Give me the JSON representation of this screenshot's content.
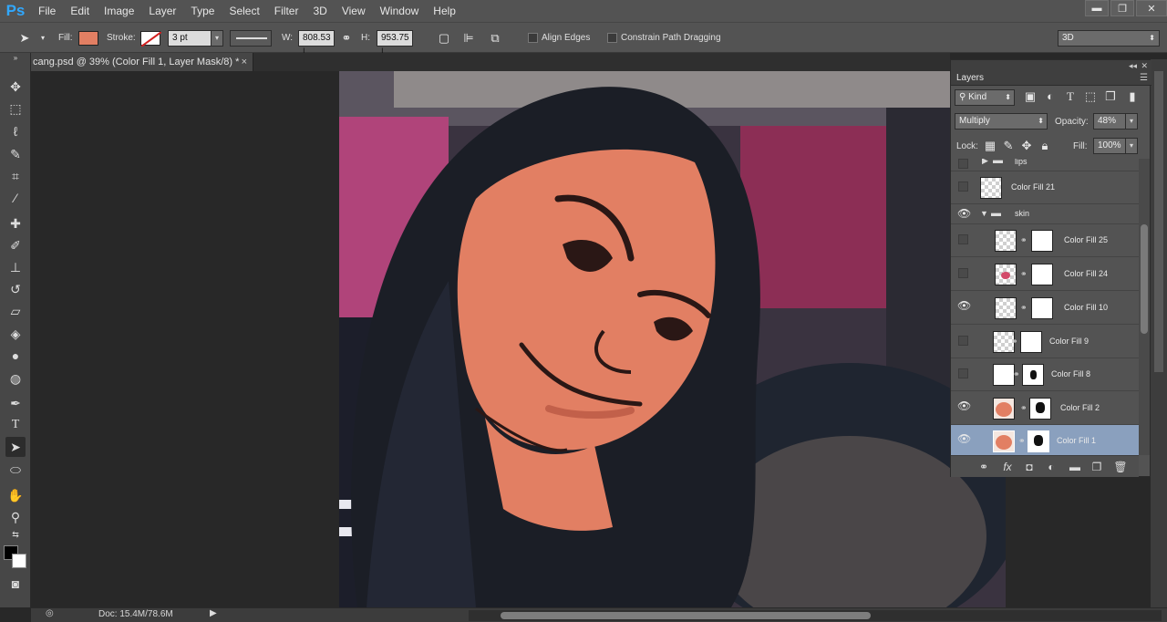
{
  "app": {
    "logo": "Ps"
  },
  "menu": [
    "File",
    "Edit",
    "Image",
    "Layer",
    "Type",
    "Select",
    "Filter",
    "3D",
    "View",
    "Window",
    "Help"
  ],
  "window_controls": {
    "minimize": "▬",
    "restore": "❐",
    "close": "✕"
  },
  "options": {
    "fill_label": "Fill:",
    "fill_color": "#e27f63",
    "stroke_label": "Stroke:",
    "stroke_width": "3 pt",
    "w_label": "W:",
    "w_value": "808.53 |",
    "h_label": "H:",
    "h_value": "953.75 |",
    "align_edges": "Align Edges",
    "constrain_path": "Constrain Path Dragging",
    "workspace": "3D"
  },
  "document": {
    "tab_title": "cang.psd @ 39% (Color Fill 1, Layer Mask/8) *",
    "close": "×"
  },
  "status": {
    "doc_size": "Doc: 15.4M/78.6M"
  },
  "layers_panel": {
    "title": "Layers",
    "filter_kind": "Kind",
    "blend_mode": "Multiply",
    "opacity_label": "Opacity:",
    "opacity_value": "48%",
    "lock_label": "Lock:",
    "fill_label": "Fill:",
    "fill_value": "100%",
    "layers": [
      {
        "name": "lips",
        "type": "group",
        "visible": false,
        "expanded": false
      },
      {
        "name": "Color Fill 21",
        "type": "fill",
        "visible": false
      },
      {
        "name": "skin",
        "type": "group",
        "visible": true,
        "expanded": true
      },
      {
        "name": "Color Fill 25",
        "type": "fill",
        "visible": false
      },
      {
        "name": "Color Fill 24",
        "type": "fill",
        "visible": false
      },
      {
        "name": "Color Fill 10",
        "type": "fill",
        "visible": true
      },
      {
        "name": "Color Fill 9",
        "type": "fill",
        "visible": false
      },
      {
        "name": "Color Fill 8",
        "type": "fill",
        "visible": false
      },
      {
        "name": "Color Fill 2",
        "type": "fill",
        "visible": true
      },
      {
        "name": "Color Fill 1",
        "type": "fill",
        "visible": true,
        "selected": true
      }
    ]
  },
  "colors": {
    "foreground": "#000000",
    "background": "#ffffff",
    "skin_fill": "#e27f63"
  }
}
